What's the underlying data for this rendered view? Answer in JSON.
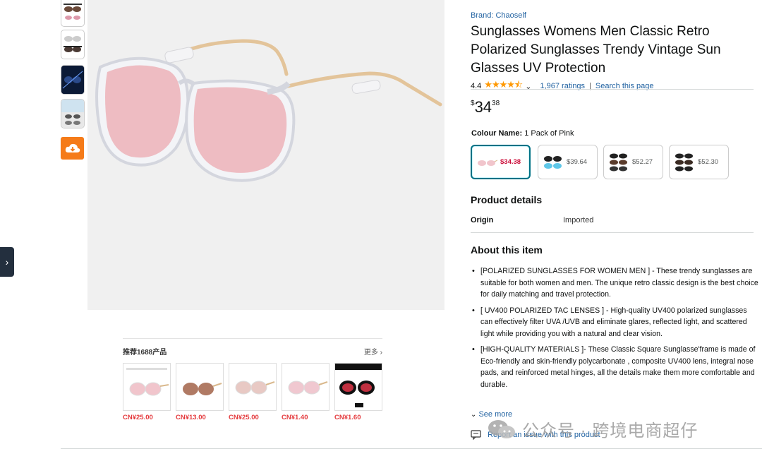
{
  "side_tab": {
    "icon": "chevron-right-icon",
    "glyph": "›"
  },
  "thumbnails": [
    {
      "name": "thumb-1",
      "icon": "sunglasses-image"
    },
    {
      "name": "thumb-2",
      "icon": "sunglasses-image"
    },
    {
      "name": "thumb-3",
      "icon": "sunglasses-image"
    },
    {
      "name": "thumb-4",
      "icon": "sunglasses-image"
    }
  ],
  "recommend": {
    "title": "推荐1688产品",
    "more": "更多 ›",
    "items": [
      {
        "price": "CN¥25.00"
      },
      {
        "price": "CN¥13.00"
      },
      {
        "price": "CN¥25.00"
      },
      {
        "price": "CN¥1.40"
      },
      {
        "price": "CN¥1.60"
      }
    ]
  },
  "product": {
    "brand": "Brand: Chaoself",
    "title": "Sunglasses Womens Men Classic Retro Polarized Sunglasses Trendy Vintage Sun Glasses UV Protection",
    "rating_value": "4.4",
    "stars": "★★★★⯪",
    "ratings_link": "1,967 ratings",
    "search_link": "Search this page",
    "price_symbol": "$",
    "price_whole": "34",
    "price_fraction": "38",
    "colour_label": "Colour Name:",
    "colour_value": "1 Pack of Pink",
    "swatches": [
      {
        "price": "$34.38",
        "selected": true
      },
      {
        "price": "$39.64",
        "selected": false
      },
      {
        "price": "$52.27",
        "selected": false
      },
      {
        "price": "$52.30",
        "selected": false
      }
    ]
  },
  "details": {
    "title": "Product details",
    "origin_label": "Origin",
    "origin_value": "Imported"
  },
  "about": {
    "title": "About this item",
    "bullets": [
      "[POLARIZED SUNGLASSES FOR WOMEN MEN ] - These trendy sunglasses are suitable for both women and men. The unique retro classic design is the best choice for daily matching and travel protection.",
      "[ UV400 POLARIZED TAC LENSES ] - High-quality UV400 polarized sunglasses can effectively filter UVA /UVB and eliminate glares, reflected light, and scattered light while providing you with a natural and clear vision.",
      "[HIGH-QUALITY MATERIALS ]- These Classic Square Sunglasse'frame is made of Eco-friendly and skin-friendly polycarbonate , composite UV400 lens, integral nose pads, and reinforced metal hinges, all the details make them more comfortable and durable."
    ],
    "see_more": "See more",
    "report": "Report an issue with this product"
  },
  "watermark": {
    "text": "公众号 · 跨境电商超仔"
  },
  "colors": {
    "link": "#2162a1",
    "accent": "#007185",
    "deal_red": "#cc0c39",
    "rec_red": "#e4393c",
    "star": "#ff9900",
    "cloud": "#f57b19"
  }
}
